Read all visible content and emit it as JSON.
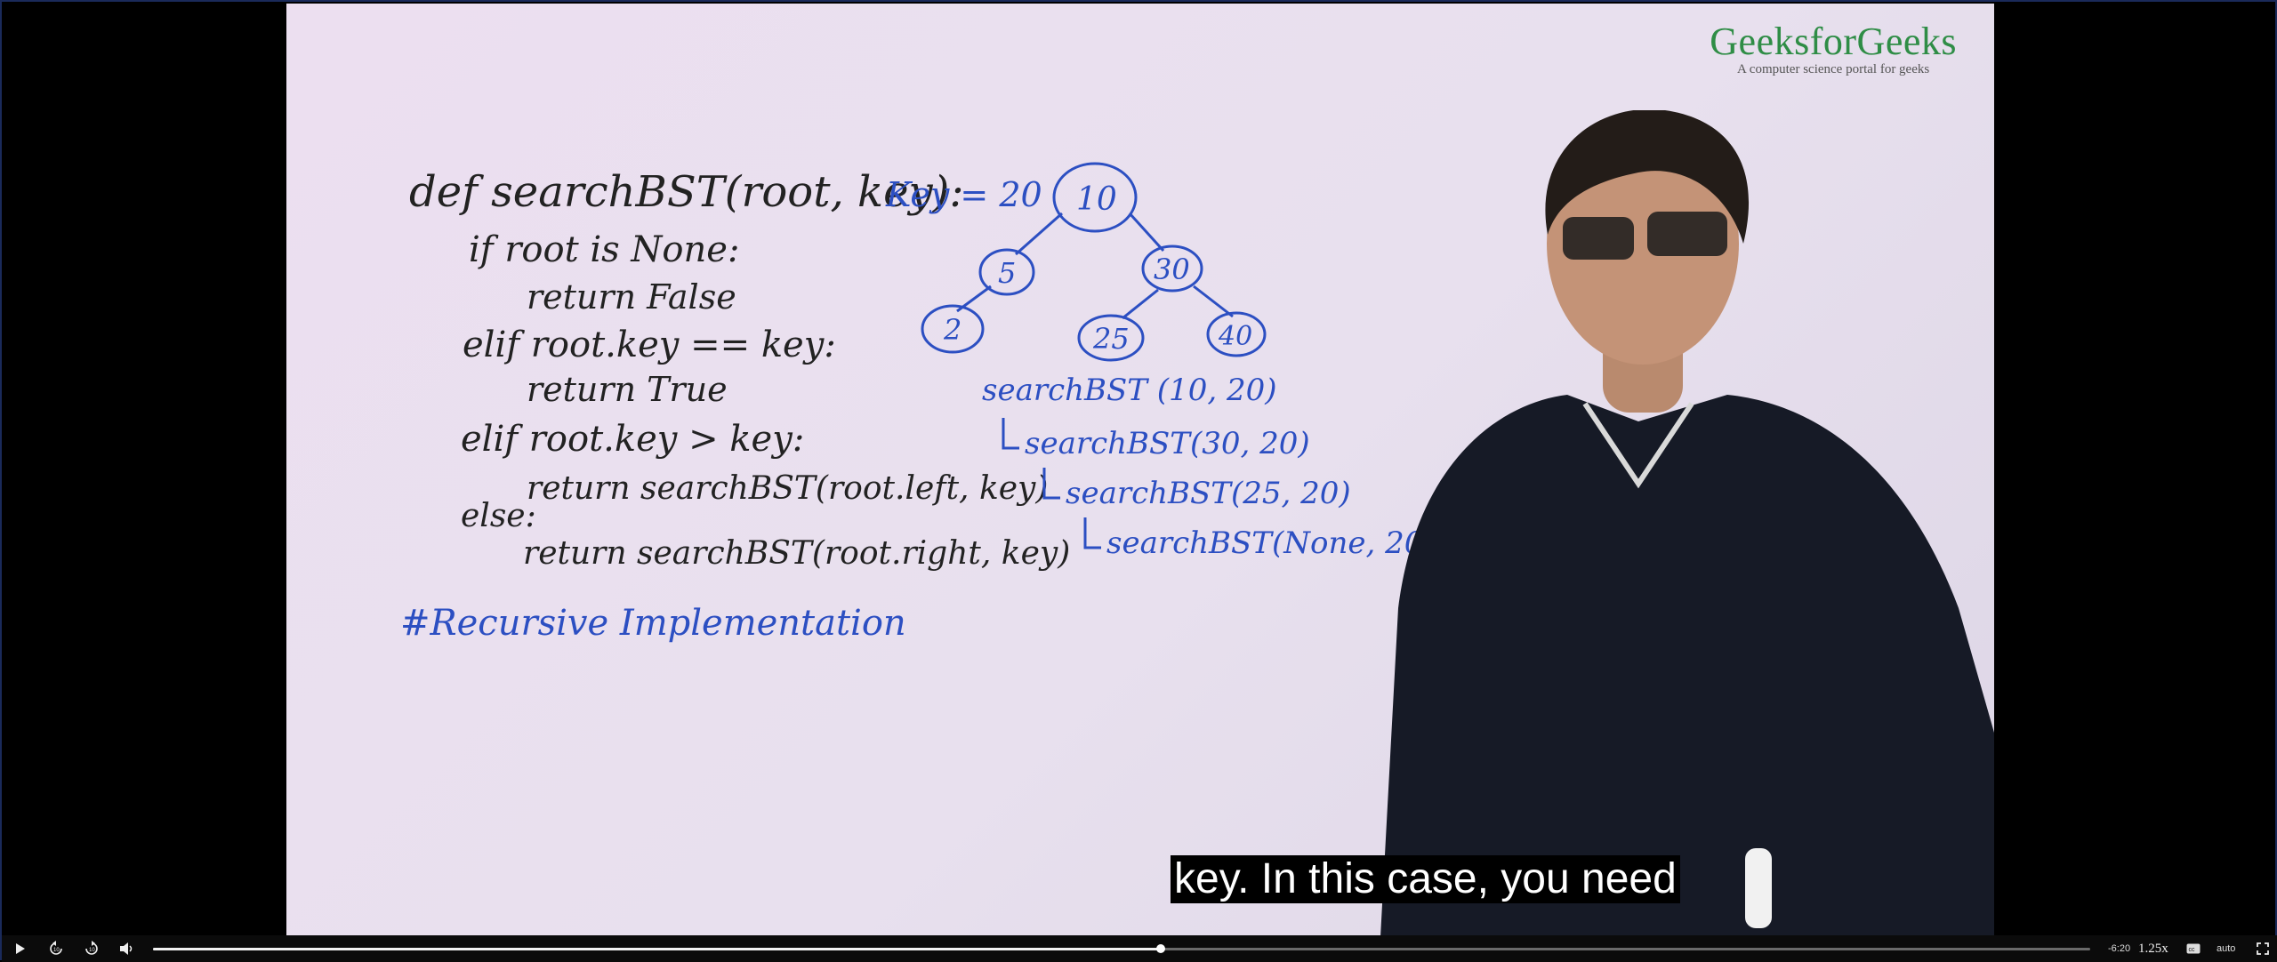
{
  "video": {
    "logo_title": "GeeksforGeeks",
    "logo_tagline": "A computer science portal for geeks",
    "subtitle": "key. In this case, you need",
    "board": {
      "code_lines": [
        "def searchBST(root, key):",
        "if root is None:",
        "return False",
        "elif root.key == key:",
        "return True",
        "elif root.key > key:",
        "return searchBST(root.left, key)",
        "else:",
        "return searchBST(root.right, key)"
      ],
      "heading": "#Recursive Implementation",
      "key_label": "Key = 20",
      "tree_nodes": [
        "10",
        "5",
        "30",
        "2",
        "25",
        "40"
      ],
      "calls": [
        "searchBST (10, 20)",
        "searchBST(30, 20)",
        "searchBST(25, 20)",
        "searchBST(None, 20)"
      ]
    },
    "colors": {
      "logo": "#2f8d46",
      "ink_black": "#222222",
      "ink_blue": "#2c4fc2",
      "board": "#ecdff0"
    }
  },
  "controls": {
    "play_icon": "play-icon",
    "rewind_icon": "rewind-10-icon",
    "forward_icon": "forward-10-icon",
    "volume_icon": "volume-icon",
    "progress": 0.52,
    "time_remaining": "-6:20",
    "speed": "1.25x",
    "captions_icon": "captions-icon",
    "quality": "auto",
    "fullscreen_icon": "fullscreen-icon"
  }
}
